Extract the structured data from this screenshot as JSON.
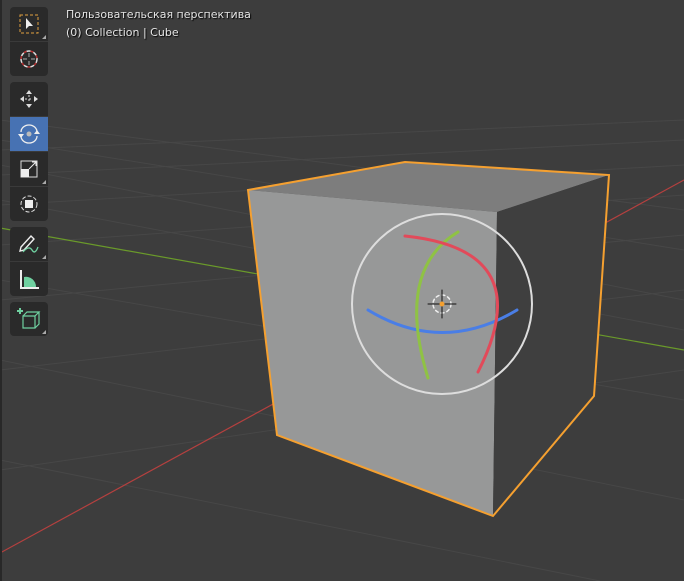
{
  "header": {
    "view_name": "Пользовательская перспектива",
    "collection_info": "(0) Collection | Cube"
  },
  "toolbar": {
    "tools": [
      {
        "name": "select-box",
        "icon": "select-box-icon",
        "active": false
      },
      {
        "name": "cursor",
        "icon": "cursor-icon",
        "active": false
      },
      {
        "name": "move",
        "icon": "move-icon",
        "active": false
      },
      {
        "name": "rotate",
        "icon": "rotate-icon",
        "active": true
      },
      {
        "name": "scale",
        "icon": "scale-icon",
        "active": false
      },
      {
        "name": "transform",
        "icon": "transform-icon",
        "active": false
      },
      {
        "name": "annotate",
        "icon": "annotate-icon",
        "active": false
      },
      {
        "name": "measure",
        "icon": "measure-icon",
        "active": false
      },
      {
        "name": "add-cube",
        "icon": "add-cube-icon",
        "active": false
      }
    ]
  },
  "colors": {
    "background": "#3d3d3d",
    "accent": "#4772b3",
    "selection": "#f5a030",
    "x_axis": "#b5403f",
    "y_axis": "#6a9a2a"
  }
}
